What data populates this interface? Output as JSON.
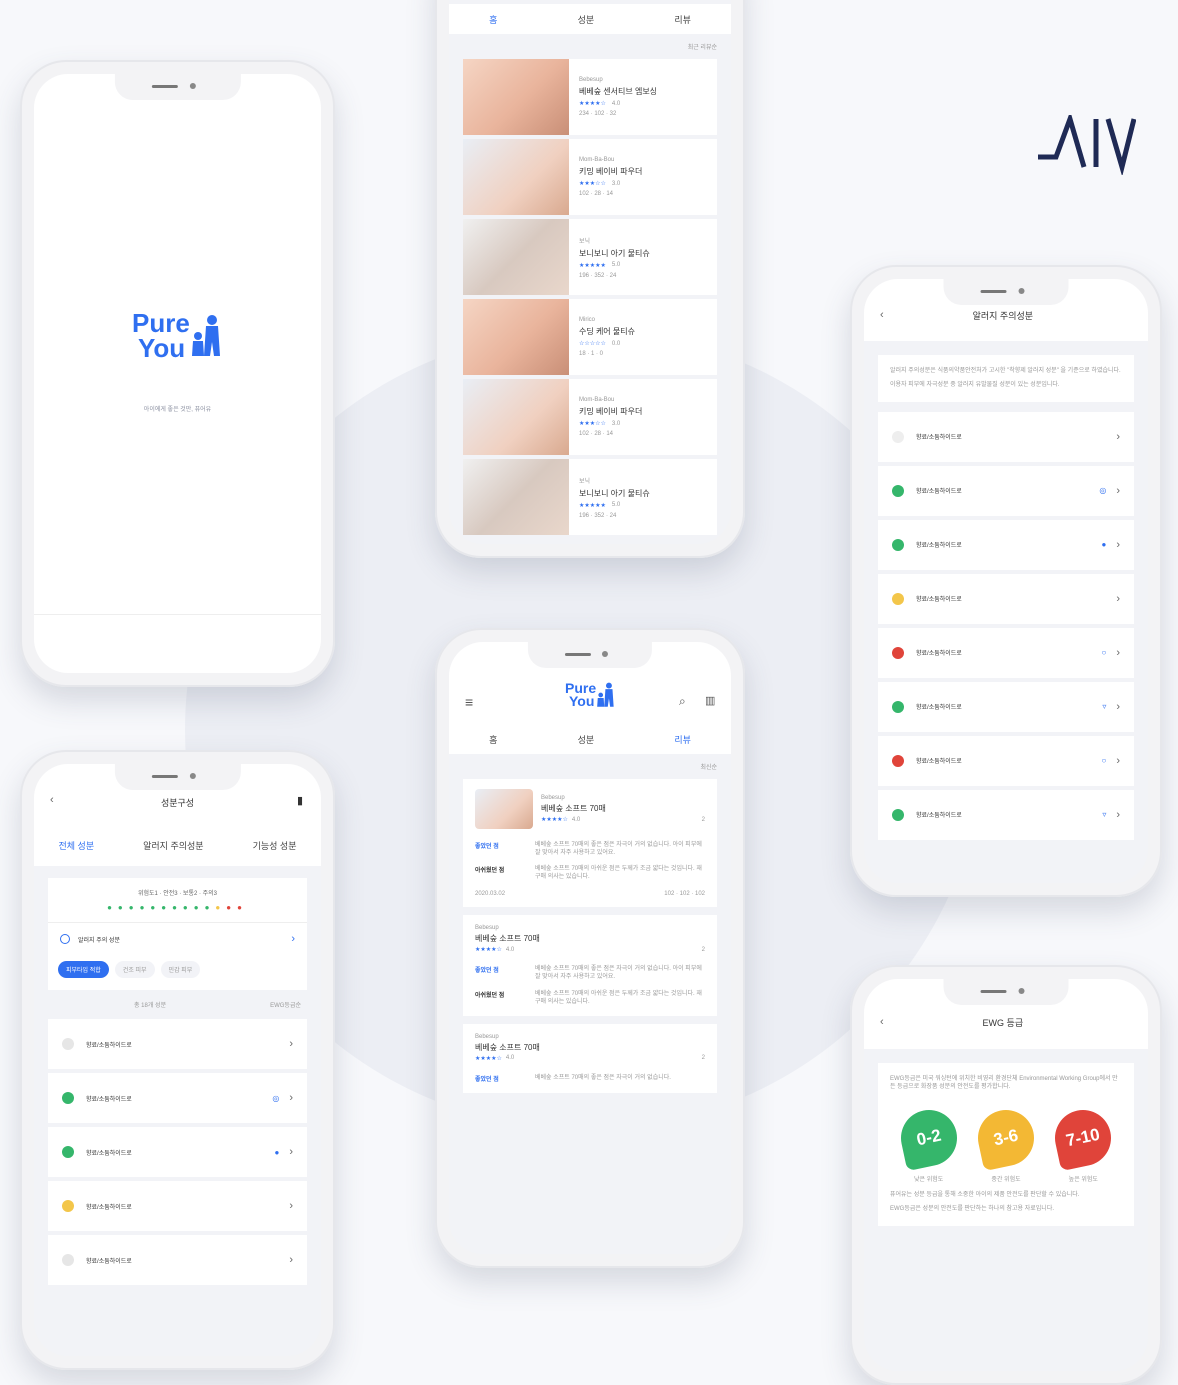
{
  "brand": {
    "mark": "ΛVIV"
  },
  "splash": {
    "logo_line1": "Pure",
    "logo_line2": "You",
    "tagline": "아이에게 좋은 것만, 퓨어유"
  },
  "list_screen": {
    "tabs": [
      "홈",
      "성분",
      "리뷰"
    ],
    "sort_label": "최근 리뷰순",
    "items": [
      {
        "brand": "Bebesup",
        "name": "베베숲 센서티브 엠보싱",
        "stars": "★★★★☆",
        "rating": "4.0",
        "stats": "234 · 102 · 32"
      },
      {
        "brand": "Mom-Ba-Bou",
        "name": "키밍 베이비 파우더",
        "stars": "★★★☆☆",
        "rating": "3.0",
        "stats": "102 · 28 · 14"
      },
      {
        "brand": "보닉",
        "name": "보니보니 아기 물티슈",
        "stars": "★★★★★",
        "rating": "5.0",
        "stats": "196 · 352 · 24"
      },
      {
        "brand": "Mirico",
        "name": "수딩 케어 물티슈",
        "stars": "☆☆☆☆☆",
        "rating": "0.0",
        "stats": "18 · 1 · 0"
      },
      {
        "brand": "Mom-Ba-Bou",
        "name": "키밍 베이비 파우더",
        "stars": "★★★☆☆",
        "rating": "3.0",
        "stats": "102 · 28 · 14"
      },
      {
        "brand": "보닉",
        "name": "보니보니 아기 물티슈",
        "stars": "★★★★★",
        "rating": "5.0",
        "stats": "196 · 352 · 24"
      }
    ]
  },
  "allergy_screen": {
    "title": "알러지 주의성분",
    "desc1": "알러지 주의성분은 식품의약품안전처가 고시한 \"착향제 알러지 성분\" 을 기준으로 하였습니다.",
    "desc2": "이용자 피부에 자극성분 중 알러지 유발물질 성분이 있는 성분입니다.",
    "rows": [
      {
        "label": "향료/소듐하이드로",
        "color": "#eeeeee",
        "icon": ""
      },
      {
        "label": "향료/소듐하이드로",
        "color": "#35b66b",
        "icon": "◎"
      },
      {
        "label": "향료/소듐하이드로",
        "color": "#35b66b",
        "icon": "●"
      },
      {
        "label": "향료/소듐하이드로",
        "color": "#f3c64a",
        "icon": ""
      },
      {
        "label": "향료/소듐하이드로",
        "color": "#e0443a",
        "icon": "○"
      },
      {
        "label": "향료/소듐하이드로",
        "color": "#35b66b",
        "icon": "▿"
      },
      {
        "label": "향료/소듐하이드로",
        "color": "#e0443a",
        "icon": "○"
      },
      {
        "label": "향료/소듐하이드로",
        "color": "#35b66b",
        "icon": "▿"
      }
    ]
  },
  "review_screen": {
    "tabs": [
      "홈",
      "성분",
      "리뷰"
    ],
    "sort_label": "최신순",
    "reviews": [
      {
        "brand": "Bebesup",
        "name": "베베숲 소프트 70매",
        "stars": "★★★★☆",
        "rating": "4.0",
        "likes": "2",
        "good_label": "좋았던 점",
        "good_text": "베베숲 소프트 70매의 좋은 점은 자극이 거의 없습니다. 아이 피부에 잘 맞아서 자주 사용하고 있어요.",
        "bad_label": "아쉬웠던 점",
        "bad_text": "베베숲 소프트 70매의 아쉬운 점은 두께가 조금 얇다는 것입니다. 재구매 의사는 있습니다.",
        "date": "2020.03.02",
        "counts": "102 · 102 · 102"
      },
      {
        "brand": "Bebesup",
        "name": "베베숲 소프트 70매",
        "stars": "★★★★☆",
        "rating": "4.0",
        "likes": "2",
        "good_label": "좋았던 점",
        "good_text": "베베숲 소프트 70매의 좋은 점은 자극이 거의 없습니다. 아이 피부에 잘 맞아서 자주 사용하고 있어요.",
        "bad_label": "아쉬웠던 점",
        "bad_text": "베베숲 소프트 70매의 아쉬운 점은 두께가 조금 얇다는 것입니다. 재구매 의사는 있습니다."
      },
      {
        "brand": "Bebesup",
        "name": "베베숲 소프트 70매",
        "stars": "★★★★☆",
        "rating": "4.0",
        "likes": "2",
        "good_label": "좋았던 점",
        "good_text": "베베숲 소프트 70매의 좋은 점은 자극이 거의 없습니다."
      }
    ]
  },
  "ingredient_screen": {
    "title": "성분구성",
    "tabs": [
      "전체 성분",
      "알러지 주의성분",
      "기능성 성분"
    ],
    "legend": "위험도1 · 안전3 · 보통2 · 주의3",
    "allergy_toggle": "알러지 주의 성분",
    "chips": [
      "피부타입 적합",
      "건조 피부",
      "민감 피부"
    ],
    "count_label": "총 18개 성분",
    "sort_label": "EWG등급순",
    "rows": [
      {
        "label": "향료/소듐하이드로",
        "color": "#e6e6e6",
        "icon": ""
      },
      {
        "label": "향료/소듐하이드로",
        "color": "#35b66b",
        "icon": "◎"
      },
      {
        "label": "향료/소듐하이드로",
        "color": "#35b66b",
        "icon": "●"
      },
      {
        "label": "향료/소듐하이드로",
        "color": "#f3c64a",
        "icon": ""
      },
      {
        "label": "향료/소듐하이드로",
        "color": "#e6e6e6",
        "icon": ""
      }
    ]
  },
  "ewg_screen": {
    "title": "EWG 등급",
    "desc1": "EWG등급은 미국 워싱턴에 위치한 비영리 환경단체 Environmental Working Group에서 만든 등급으로 화장품 성분의 안전도를 평가합니다.",
    "badges": [
      {
        "label": "0-2",
        "color": "#35b66b",
        "caption": "낮은 위험도"
      },
      {
        "label": "3-6",
        "color": "#f3b834",
        "caption": "중간 위험도"
      },
      {
        "label": "7-10",
        "color": "#e0443a",
        "caption": "높은 위험도"
      }
    ],
    "desc2": "퓨어유는 성분 등급을 통해 소중한 아이의 제품 안전도를 판단할 수 있습니다.",
    "desc3": "EWG등급은 성분의 안전도를 판단하는 하나의 참고용 자료입니다."
  }
}
